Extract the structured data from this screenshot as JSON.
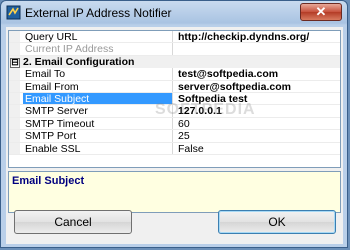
{
  "window": {
    "title": "External IP Address Notifier",
    "close_glyph": "✕",
    "app_icon": "network-icon"
  },
  "grid": {
    "rows": [
      {
        "type": "property",
        "name": "Query URL",
        "value": "http://checkip.dyndns.org/"
      },
      {
        "type": "property",
        "name": "Current IP Address",
        "value": "",
        "disabled": true
      },
      {
        "type": "category",
        "label": "2. Email Configuration",
        "expander": "⊟"
      },
      {
        "type": "property",
        "name": "Email To",
        "value": "test@softpedia.com"
      },
      {
        "type": "property",
        "name": "Email From",
        "value": "server@softpedia.com"
      },
      {
        "type": "property",
        "name": "Email Subject",
        "value": "Softpedia test",
        "selected": true
      },
      {
        "type": "property",
        "name": "SMTP Server",
        "value": "127.0.0.1"
      },
      {
        "type": "property",
        "name": "SMTP Timeout",
        "value": "60"
      },
      {
        "type": "property",
        "name": "SMTP Port",
        "value": "25"
      },
      {
        "type": "property",
        "name": "Enable SSL",
        "value": "False"
      }
    ]
  },
  "description": {
    "title": "Email Subject"
  },
  "watermark": "SOFTPEDIA",
  "buttons": {
    "cancel": "Cancel",
    "ok": "OK"
  }
}
